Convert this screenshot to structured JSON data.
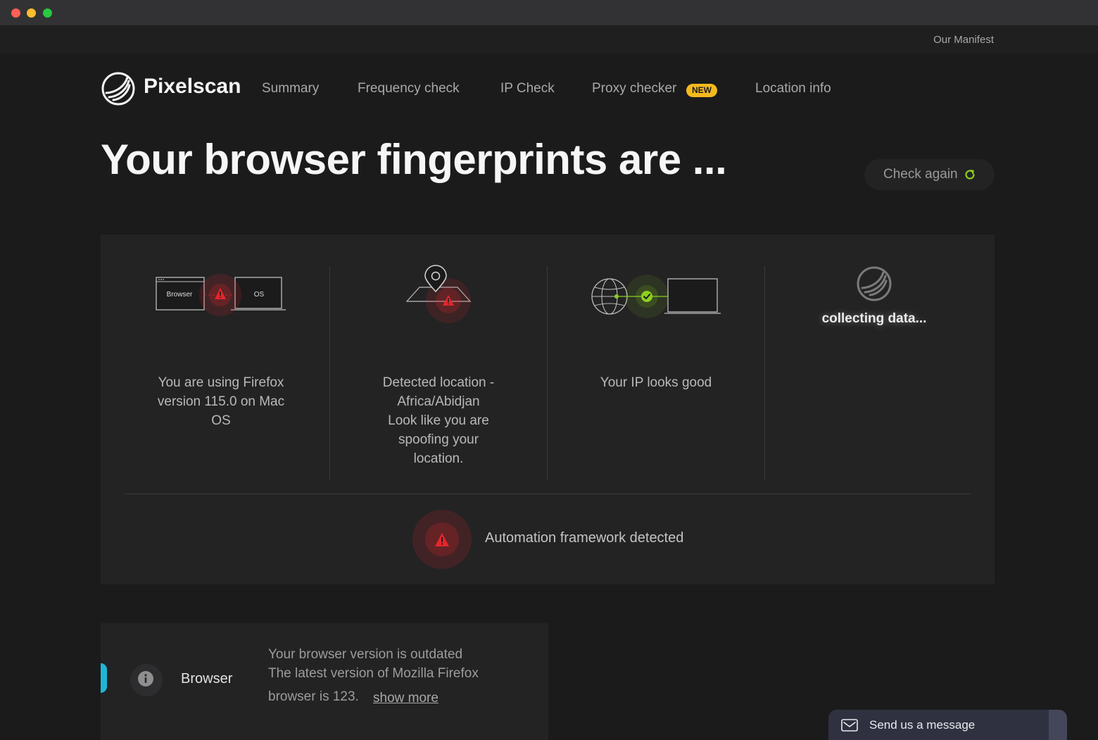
{
  "window": {
    "title": ""
  },
  "topbar": {
    "manifest_link": "Our Manifest"
  },
  "brand": {
    "name": "Pixelscan"
  },
  "nav": {
    "items": [
      {
        "label": "Summary"
      },
      {
        "label": "Frequency check"
      },
      {
        "label": "IP Check"
      },
      {
        "label": "Proxy checker"
      },
      {
        "label": "Location info"
      }
    ],
    "new_badge": "NEW"
  },
  "hero": {
    "title": "Your browser fingerprints are ...",
    "check_again_label": "Check again"
  },
  "cards": {
    "browser": {
      "browser_label": "Browser",
      "os_label": "OS",
      "line1": "You are using Firefox",
      "line2": "version 115.0 on Mac",
      "line3": "OS",
      "status": "warning"
    },
    "location": {
      "line1": "Detected location -",
      "line2": "Africa/Abidjan",
      "line3": "Look like you are",
      "line4": "spoofing your",
      "line5": "location.",
      "status": "warning"
    },
    "ip": {
      "text": "Your IP looks good",
      "status": "ok"
    },
    "collecting": {
      "text": "collecting data..."
    }
  },
  "automation": {
    "text": "Automation framework detected",
    "status": "warning"
  },
  "browser_detail": {
    "label": "Browser",
    "line1": "Your browser version is outdated",
    "line2": "The latest version of Mozilla Firefox",
    "line3": "browser is 123.",
    "show_more": "show more"
  },
  "chat": {
    "label": "Send us a message"
  },
  "colors": {
    "background": "#1b1b1c",
    "panel": "#232324",
    "warning": "#e5262c",
    "ok": "#8ccf1e",
    "accent_blue": "#1fb6d6",
    "badge": "#f5b91e"
  },
  "icons": {
    "logo": "pixelscan-logo-icon",
    "refresh": "refresh-icon",
    "warning": "warning-triangle-icon",
    "check": "check-circle-icon",
    "globe": "globe-icon",
    "location": "location-pin-icon",
    "info": "info-icon",
    "mail": "mail-icon"
  }
}
